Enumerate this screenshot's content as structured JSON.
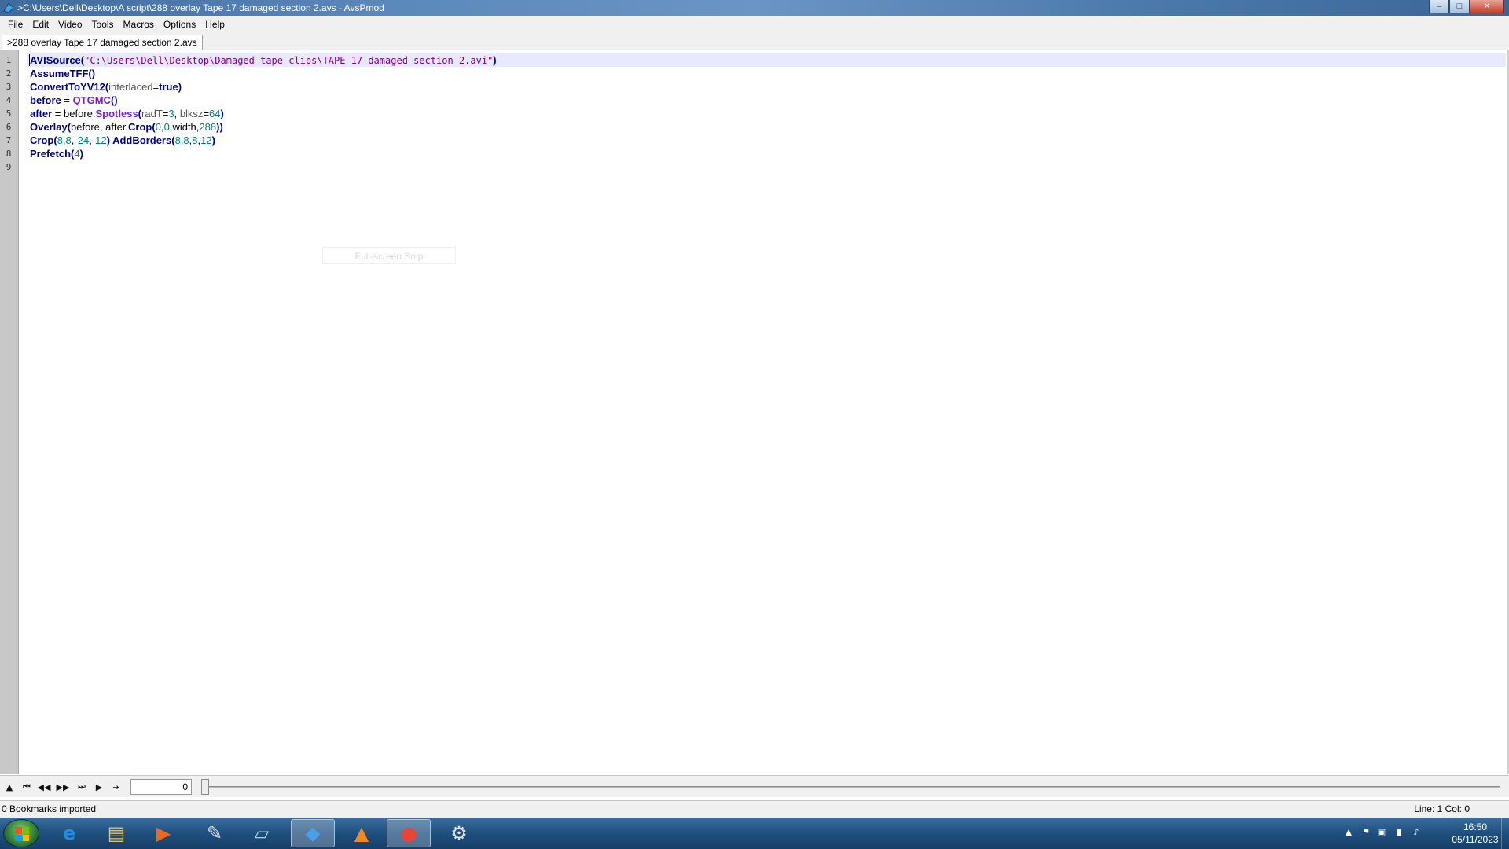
{
  "window": {
    "title": ">C:\\Users\\Dell\\Desktop\\A script\\288 overlay Tape 17 damaged section 2.avs - AvsPmod",
    "controls": {
      "minimize": "–",
      "maximize": "□",
      "close": "✕"
    }
  },
  "menu": {
    "items": [
      "File",
      "Edit",
      "Video",
      "Tools",
      "Macros",
      "Options",
      "Help"
    ]
  },
  "tabs": [
    {
      "label": ">288 overlay Tape 17 damaged section 2.avs"
    }
  ],
  "editor": {
    "line_numbers": [
      "1",
      "2",
      "3",
      "4",
      "5",
      "6",
      "7",
      "8",
      "9"
    ],
    "lines": [
      [
        {
          "t": "AVISource",
          "c": "kw"
        },
        {
          "t": "(",
          "c": "kw"
        },
        {
          "t": "\"C:\\Users\\Dell\\Desktop\\Damaged tape clips\\TAPE 17 damaged section 2.avi\"",
          "c": "str"
        },
        {
          "t": ")",
          "c": "kw"
        }
      ],
      [
        {
          "t": "AssumeTFF()",
          "c": "kw"
        }
      ],
      [
        {
          "t": "ConvertToYV12(",
          "c": "kw"
        },
        {
          "t": "interlaced",
          "c": "arg"
        },
        {
          "t": "=",
          "c": "plain"
        },
        {
          "t": "true",
          "c": "const"
        },
        {
          "t": ")",
          "c": "kw"
        }
      ],
      [
        {
          "t": "before",
          "c": "kw"
        },
        {
          "t": " = ",
          "c": "plain"
        },
        {
          "t": "QTGMC",
          "c": "fn"
        },
        {
          "t": "()",
          "c": "kw"
        }
      ],
      [
        {
          "t": "after",
          "c": "kw"
        },
        {
          "t": " = before.",
          "c": "plain"
        },
        {
          "t": "Spotless",
          "c": "fn"
        },
        {
          "t": "(",
          "c": "kw"
        },
        {
          "t": "radT",
          "c": "arg"
        },
        {
          "t": "=",
          "c": "plain"
        },
        {
          "t": "3",
          "c": "num"
        },
        {
          "t": ", ",
          "c": "plain"
        },
        {
          "t": "blksz",
          "c": "arg"
        },
        {
          "t": "=",
          "c": "plain"
        },
        {
          "t": "64",
          "c": "num"
        },
        {
          "t": ")",
          "c": "kw"
        }
      ],
      [
        {
          "t": "Overlay",
          "c": "kw"
        },
        {
          "t": "(",
          "c": "kw"
        },
        {
          "t": "before, after.",
          "c": "plain"
        },
        {
          "t": "Crop",
          "c": "kw"
        },
        {
          "t": "(",
          "c": "kw"
        },
        {
          "t": "0",
          "c": "num"
        },
        {
          "t": ",",
          "c": "plain"
        },
        {
          "t": "0",
          "c": "num"
        },
        {
          "t": ",width,",
          "c": "plain"
        },
        {
          "t": "288",
          "c": "num"
        },
        {
          "t": "))",
          "c": "kw"
        }
      ],
      [
        {
          "t": "Crop",
          "c": "kw"
        },
        {
          "t": "(",
          "c": "kw"
        },
        {
          "t": "8",
          "c": "num"
        },
        {
          "t": ",",
          "c": "plain"
        },
        {
          "t": "8",
          "c": "num"
        },
        {
          "t": ",",
          "c": "plain"
        },
        {
          "t": "-24",
          "c": "num"
        },
        {
          "t": ",",
          "c": "plain"
        },
        {
          "t": "-12",
          "c": "num"
        },
        {
          "t": ") ",
          "c": "kw"
        },
        {
          "t": "AddBorders",
          "c": "kw"
        },
        {
          "t": "(",
          "c": "kw"
        },
        {
          "t": "8",
          "c": "num"
        },
        {
          "t": ",",
          "c": "plain"
        },
        {
          "t": "8",
          "c": "num"
        },
        {
          "t": ",",
          "c": "plain"
        },
        {
          "t": "8",
          "c": "num"
        },
        {
          "t": ",",
          "c": "plain"
        },
        {
          "t": "12",
          "c": "num"
        },
        {
          "t": ")",
          "c": "kw"
        }
      ],
      [
        {
          "t": "Prefetch",
          "c": "kw"
        },
        {
          "t": "(",
          "c": "kw"
        },
        {
          "t": "4",
          "c": "num"
        },
        {
          "t": ")",
          "c": "kw"
        }
      ],
      []
    ],
    "ghost_text": "Full-screen Snip"
  },
  "video_controls": {
    "buttons": [
      {
        "name": "toggle-preview-button",
        "glyph": "▲"
      },
      {
        "name": "first-frame-button",
        "glyph": "⏮"
      },
      {
        "name": "prev-frame-button",
        "glyph": "◀◀"
      },
      {
        "name": "next-frame-button",
        "glyph": "▶▶"
      },
      {
        "name": "last-frame-button",
        "glyph": "⏭"
      },
      {
        "name": "play-button",
        "glyph": "▶"
      },
      {
        "name": "goto-frame-button",
        "glyph": "⇥"
      }
    ],
    "frame_value": "0",
    "slider_position": 0
  },
  "status": {
    "left": "0 Bookmarks imported",
    "right": "Line: 1  Col: 0"
  },
  "taskbar": {
    "clock_time": "16:50",
    "clock_date": "05/11/2023",
    "apps": [
      {
        "name": "internet-explorer-icon",
        "glyph": "e",
        "color": "#1e8fe0"
      },
      {
        "name": "file-explorer-icon",
        "glyph": "▤",
        "color": "#e8c25a"
      },
      {
        "name": "media-player-icon",
        "glyph": "▶",
        "color": "#e86a1e"
      },
      {
        "name": "paint-icon",
        "glyph": "✎",
        "color": "#d8d8e8"
      },
      {
        "name": "notepad-icon",
        "glyph": "▱",
        "color": "#a8d0f0"
      },
      {
        "name": "avspmod-icon",
        "glyph": "◆",
        "color": "#4aa0e8",
        "active": true
      },
      {
        "name": "vlc-icon",
        "glyph": "▲",
        "color": "#f08a1e"
      },
      {
        "name": "chrome-icon",
        "glyph": "●",
        "color": "#e8443a",
        "active": true
      },
      {
        "name": "settings-icon",
        "glyph": "⚙",
        "color": "#e0e0e0"
      }
    ]
  },
  "colors": {
    "keyword": "#000080",
    "function": "#7a1fbf",
    "string": "#7f007f",
    "number": "#007f7f"
  }
}
